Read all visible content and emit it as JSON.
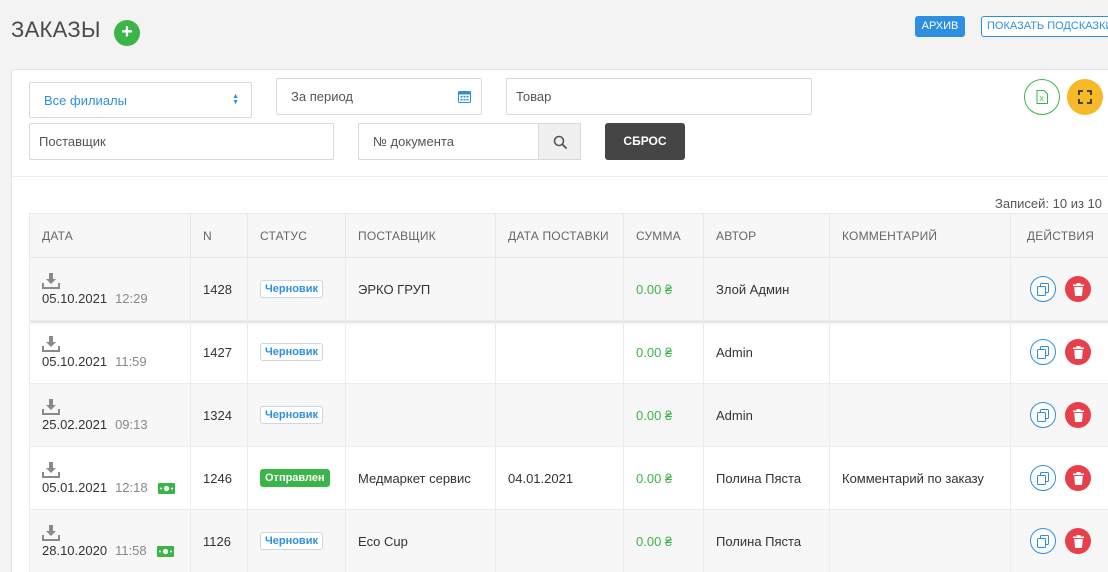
{
  "header": {
    "title": "ЗАКАЗЫ",
    "add_symbol": "+",
    "archive_label": "АРХИВ",
    "hints_label": "ПОКАЗАТЬ ПОДСКАЗКИ"
  },
  "filters": {
    "branch_value": "Все филиалы",
    "period_placeholder": "За период",
    "product_placeholder": "Товар",
    "supplier_placeholder": "Поставщик",
    "docnum_placeholder": "№ документа",
    "reset_label": "СБРОС"
  },
  "records_label": "Записей: 10 из 10",
  "table": {
    "columns": [
      "ДАТА",
      "N",
      "СТАТУС",
      "ПОСТАВЩИК",
      "ДАТА ПОСТАВКИ",
      "СУММА",
      "АВТОР",
      "КОММЕНТАРИЙ",
      "ДЕЙСТВИЯ"
    ],
    "rows": [
      {
        "date": "05.10.2021",
        "time": "12:29",
        "money": false,
        "n": "1428",
        "status": "Черновик",
        "status_kind": "draft",
        "supplier": "ЭРКО ГРУП",
        "delivery": "",
        "sum": "0.00 ₴",
        "author": "Злой Админ",
        "comment": ""
      },
      {
        "date": "05.10.2021",
        "time": "11:59",
        "money": false,
        "n": "1427",
        "status": "Черновик",
        "status_kind": "draft",
        "supplier": "",
        "delivery": "",
        "sum": "0.00 ₴",
        "author": "Admin",
        "comment": ""
      },
      {
        "date": "25.02.2021",
        "time": "09:13",
        "money": false,
        "n": "1324",
        "status": "Черновик",
        "status_kind": "draft",
        "supplier": "",
        "delivery": "",
        "sum": "0.00 ₴",
        "author": "Admin",
        "comment": ""
      },
      {
        "date": "05.01.2021",
        "time": "12:18",
        "money": true,
        "n": "1246",
        "status": "Отправлен",
        "status_kind": "sent",
        "supplier": "Медмаркет сервис",
        "delivery": "04.01.2021",
        "sum": "0.00 ₴",
        "author": "Полина Пяста",
        "comment": "Комментарий по заказу"
      },
      {
        "date": "28.10.2020",
        "time": "11:58",
        "money": true,
        "n": "1126",
        "status": "Черновик",
        "status_kind": "draft",
        "supplier": "Eco Cup",
        "delivery": "",
        "sum": "0.00 ₴",
        "author": "Полина Пяста",
        "comment": ""
      }
    ]
  },
  "colors": {
    "accent_blue": "#2e8fe0",
    "green": "#3bb54a",
    "danger": "#e8404a",
    "reset_bg": "#454545",
    "fullscreen_bg": "#f7b928"
  },
  "icons": [
    "plus-icon",
    "calendar-icon",
    "search-icon",
    "excel-icon",
    "fullscreen-icon",
    "download-icon",
    "money-icon",
    "copy-icon",
    "trash-icon",
    "select-arrows-icon"
  ]
}
